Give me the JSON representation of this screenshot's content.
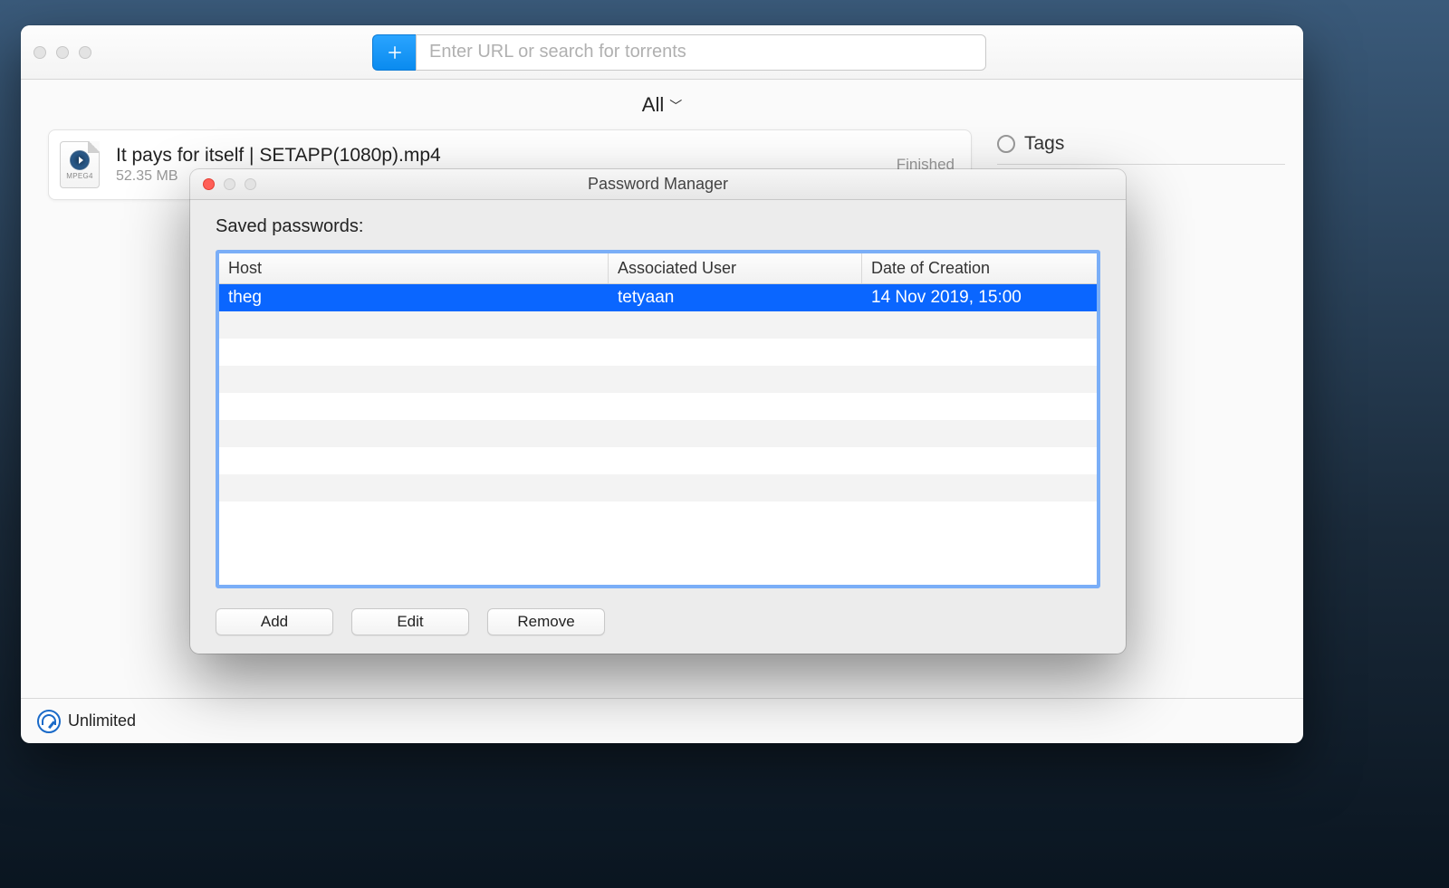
{
  "toolbar": {
    "search_placeholder": "Enter URL or search for torrents"
  },
  "filter": {
    "label": "All"
  },
  "download": {
    "title": "It pays for itself | SETAPP(1080p).mp4",
    "size": "52.35 MB",
    "status": "Finished",
    "icon_label": "MPEG4"
  },
  "sidebar": {
    "tags_label": "Tags"
  },
  "footer": {
    "speed_label": "Unlimited"
  },
  "modal": {
    "title": "Password Manager",
    "label": "Saved passwords:",
    "columns": {
      "host": "Host",
      "user": "Associated User",
      "date": "Date of Creation"
    },
    "rows": [
      {
        "host": "theg",
        "user": "tetyaan",
        "date": "14 Nov 2019, 15:00"
      }
    ],
    "buttons": {
      "add": "Add",
      "edit": "Edit",
      "remove": "Remove"
    }
  }
}
